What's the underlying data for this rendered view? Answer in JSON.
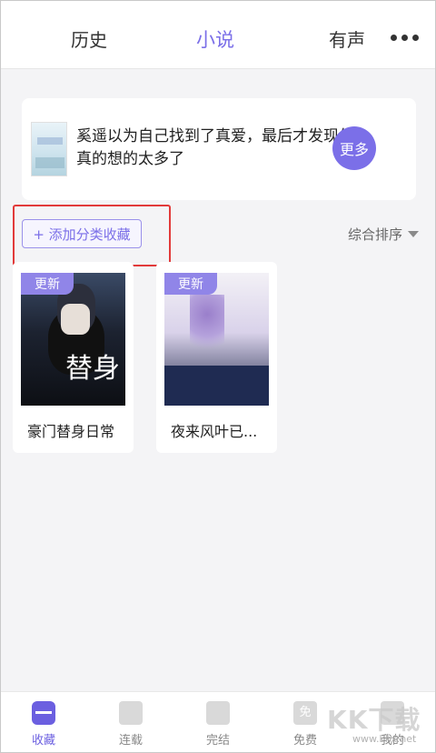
{
  "header": {
    "tabs": [
      {
        "label": "历史"
      },
      {
        "label": "小说"
      },
      {
        "label": "有声"
      }
    ],
    "active_tab": "小说",
    "more_icon": "more-dots-icon",
    "accent_color": "#7b6fe8"
  },
  "recommendation": {
    "text": "奚遥以为自己找到了真爱，最后才发现他真的想的太多了",
    "more_label": "更多"
  },
  "toolbar": {
    "add_category_label": "+ 添加分类收藏",
    "sort_label": "综合排序"
  },
  "books": [
    {
      "title": "豪门替身日常",
      "badge": "更新",
      "cover_text": "替身"
    },
    {
      "title": "夜来风叶已...",
      "badge": "更新"
    }
  ],
  "bottom_nav": {
    "items": [
      {
        "label": "收藏",
        "icon": "bookmark-stack-icon"
      },
      {
        "label": "连载",
        "icon": "edit-book-icon"
      },
      {
        "label": "完结",
        "icon": "finished-book-icon"
      },
      {
        "label": "免费",
        "icon": "free-icon",
        "icon_text": "免"
      },
      {
        "label": "我的",
        "icon": "profile-icon"
      }
    ],
    "active": "收藏"
  },
  "watermark": {
    "text": "KK下载",
    "url": "www.kkx.net"
  }
}
